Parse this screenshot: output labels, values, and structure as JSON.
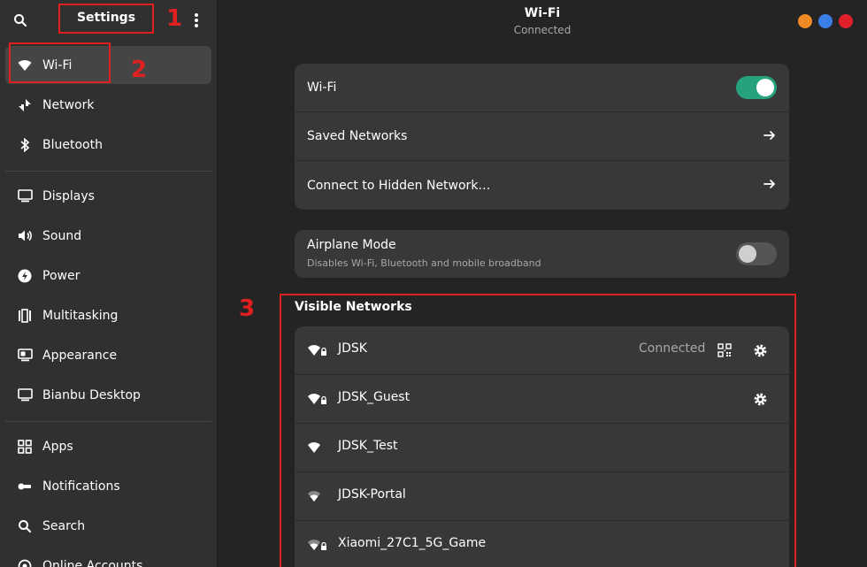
{
  "sidebar": {
    "title": "Settings",
    "items": [
      {
        "label": "Wi-Fi",
        "icon": "wifi-icon"
      },
      {
        "label": "Network",
        "icon": "network-icon"
      },
      {
        "label": "Bluetooth",
        "icon": "bluetooth-icon"
      },
      {
        "label": "Displays",
        "icon": "display-icon"
      },
      {
        "label": "Sound",
        "icon": "sound-icon"
      },
      {
        "label": "Power",
        "icon": "power-icon"
      },
      {
        "label": "Multitasking",
        "icon": "multitasking-icon"
      },
      {
        "label": "Appearance",
        "icon": "appearance-icon"
      },
      {
        "label": "Bianbu Desktop",
        "icon": "desktop-icon"
      },
      {
        "label": "Apps",
        "icon": "apps-icon"
      },
      {
        "label": "Notifications",
        "icon": "bell-icon"
      },
      {
        "label": "Search",
        "icon": "search-icon"
      },
      {
        "label": "Online Accounts",
        "icon": "accounts-icon"
      }
    ]
  },
  "header": {
    "title": "Wi-Fi",
    "subtitle": "Connected",
    "window_buttons": {
      "minimize": "#f08a24",
      "maximize": "#3c7ee8",
      "close": "#e0202a"
    }
  },
  "wifi_card": {
    "wifi_label": "Wi-Fi",
    "wifi_enabled": true,
    "saved_networks": "Saved Networks",
    "hidden_network": "Connect to Hidden Network…"
  },
  "airplane_card": {
    "label": "Airplane Mode",
    "description": "Disables Wi-Fi, Bluetooth and mobile broadband",
    "enabled": false
  },
  "visible_networks": {
    "title": "Visible Networks",
    "networks": [
      {
        "name": "JDSK",
        "status": "Connected",
        "secured": true
      },
      {
        "name": "JDSK_Guest",
        "status": "",
        "secured": true
      },
      {
        "name": "JDSK_Test",
        "status": "",
        "secured": false
      },
      {
        "name": "JDSK-Portal",
        "status": "",
        "secured": false
      },
      {
        "name": "Xiaomi_27C1_5G_Game",
        "status": "",
        "secured": true
      }
    ]
  },
  "annotations": {
    "one": "1",
    "two": "2",
    "three": "3",
    "color": "#e02020"
  },
  "colors": {
    "accent": "#26a37e",
    "sidebar_bg": "#303030",
    "card_bg": "#383838",
    "window_bg": "#242424"
  }
}
